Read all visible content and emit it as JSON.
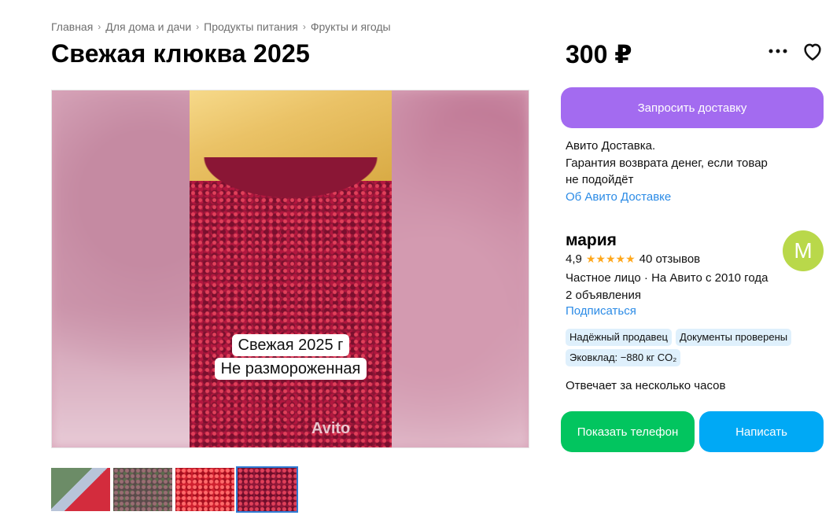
{
  "breadcrumbs": [
    "Главная",
    "Для дома и дачи",
    "Продукты питания",
    "Фрукты и ягоды"
  ],
  "listing": {
    "title": "Свежая клюква 2025",
    "price": "300 ₽",
    "image_caption_line1": "Свежая 2025 г",
    "image_caption_line2": "Не размороженная",
    "watermark": "Avito",
    "thumbnails_count": 4,
    "active_thumbnail": 4
  },
  "delivery": {
    "button_label": "Запросить доставку",
    "line1": "Авито Доставка.",
    "line2": "Гарантия возврата денег, если товар",
    "line3": "не подойдёт",
    "link": "Об Авито Доставке"
  },
  "seller": {
    "name": "мария",
    "avatar_letter": "M",
    "avatar_color": "#b9d84a",
    "rating": "4,9",
    "stars": "★★★★★",
    "reviews": "40 отзывов",
    "type_since": "Частное лицо · На Авито с 2010 года",
    "ads_count": "2 объявления",
    "subscribe_label": "Подписаться",
    "badges": [
      "Надёжный продавец",
      "Документы проверены",
      "Эковклад: −880 кг CO₂"
    ],
    "response_time": "Отвечает за несколько часов"
  },
  "actions": {
    "show_phone": "Показать телефон",
    "write": "Написать"
  },
  "colors": {
    "delivery_button": "#a36bf0",
    "phone_button": "#02c55f",
    "write_button": "#00a9f5",
    "link": "#2b8be6",
    "badge_bg": "#dff0fc",
    "star": "#ffa81d"
  }
}
